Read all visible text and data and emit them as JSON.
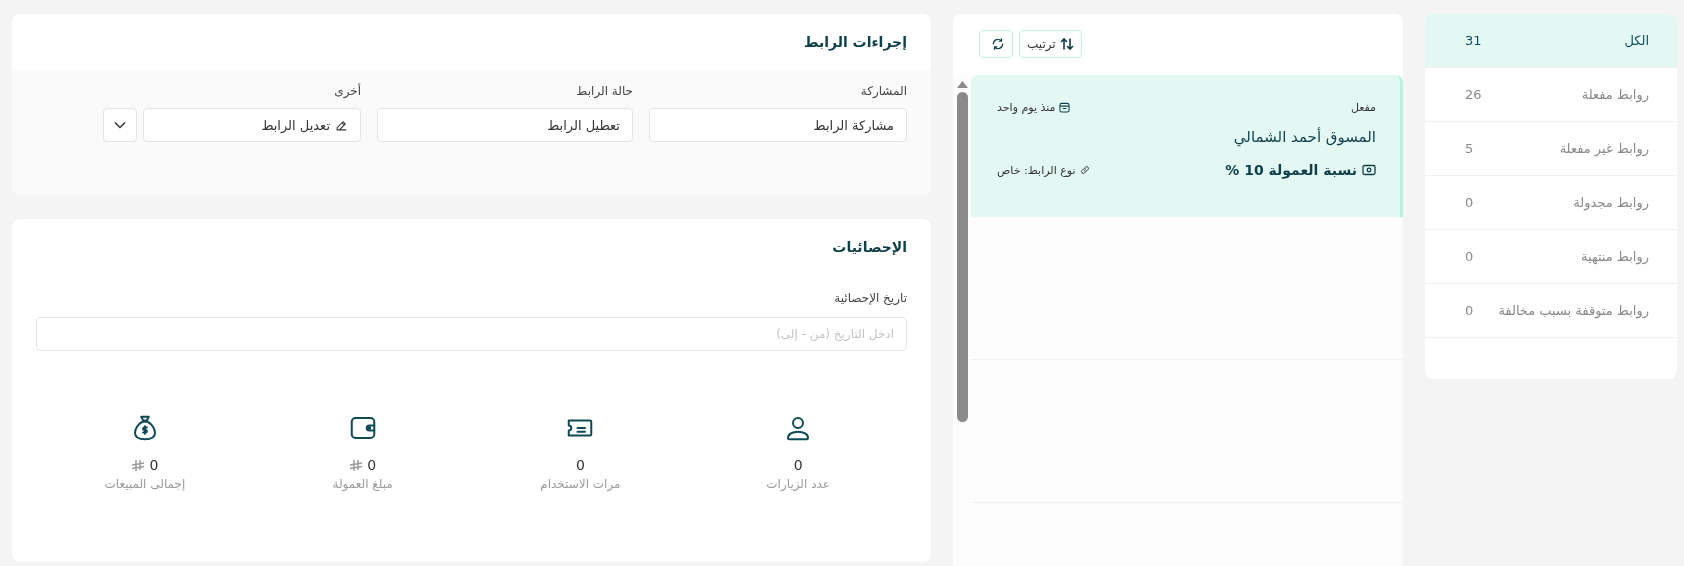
{
  "filters": [
    {
      "label": "الكل",
      "count": "31",
      "selected": true
    },
    {
      "label": "روابط مفعلة",
      "count": "26",
      "selected": false
    },
    {
      "label": "روابط غير مفعلة",
      "count": "5",
      "selected": false
    },
    {
      "label": "روابط مجدولة",
      "count": "0",
      "selected": false
    },
    {
      "label": "روابط منتهية",
      "count": "0",
      "selected": false
    },
    {
      "label": "روابط متوقفة بسبب مخالفة",
      "count": "0",
      "selected": false
    }
  ],
  "toolbar": {
    "sort_button": "ترتيب"
  },
  "links": [
    {
      "status": "مفعل",
      "age": "منذ يوم واحد",
      "marketer": "المسوق أحمد الشمالي",
      "commission": "نسبة العمولة 10 %",
      "link_type": "نوع الرابط: خاص",
      "selected": true
    }
  ],
  "link_actions": {
    "title": "إجراءات الرابط",
    "groups": [
      {
        "kind": "share",
        "label": "المشاركة",
        "button": "مشاركة الرابط"
      },
      {
        "kind": "status",
        "label": "حالة الرابط",
        "button": "تعطيل الرابط"
      },
      {
        "kind": "other",
        "label": "أخرى",
        "button": "تعديل الرابط"
      }
    ]
  },
  "statistics": {
    "title": "الإحصائيات",
    "date_label": "تاريخ الإحصائية",
    "date_placeholder": "ادخل التاريخ (من - إلى)",
    "items": [
      {
        "kind": "visits",
        "value": "0",
        "label": "عدد الزيارات",
        "currency": false
      },
      {
        "kind": "uses",
        "value": "0",
        "label": "مرات الاستخدام",
        "currency": false
      },
      {
        "kind": "commission",
        "value": "0",
        "label": "مبلغ العمولة",
        "currency": true
      },
      {
        "kind": "sales",
        "value": "0",
        "label": "إجمالى المبيعات",
        "currency": true
      }
    ]
  }
}
